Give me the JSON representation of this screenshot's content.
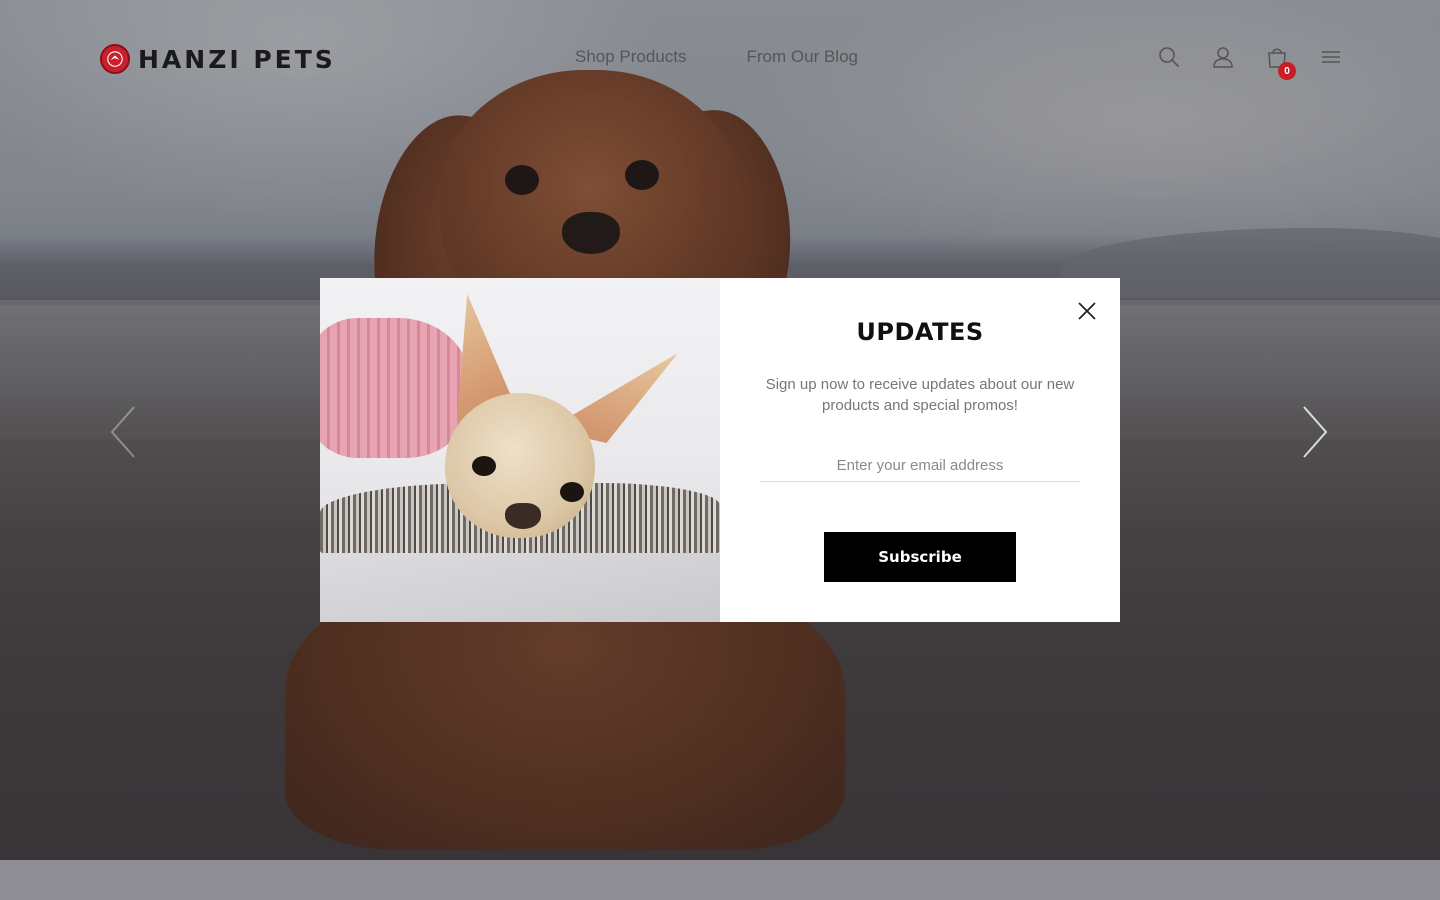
{
  "brand": {
    "name": "HANZI PETS",
    "accent_color": "#c8202c"
  },
  "nav": {
    "items": [
      {
        "label": "Shop Products"
      },
      {
        "label": "From Our Blog"
      }
    ]
  },
  "header_icons": {
    "search": "search-icon",
    "account": "user-icon",
    "cart": "shopping-bag-icon",
    "menu": "hamburger-menu-icon",
    "cart_count": "0"
  },
  "slider": {
    "prev_icon": "chevron-left-icon",
    "next_icon": "chevron-right-icon"
  },
  "popup": {
    "title": "UPDATES",
    "description": "Sign up now to receive updates about our new products and special promos!",
    "email_placeholder": "Enter your email address",
    "email_value": "",
    "subscribe_label": "Subscribe",
    "close_icon": "close-icon"
  }
}
